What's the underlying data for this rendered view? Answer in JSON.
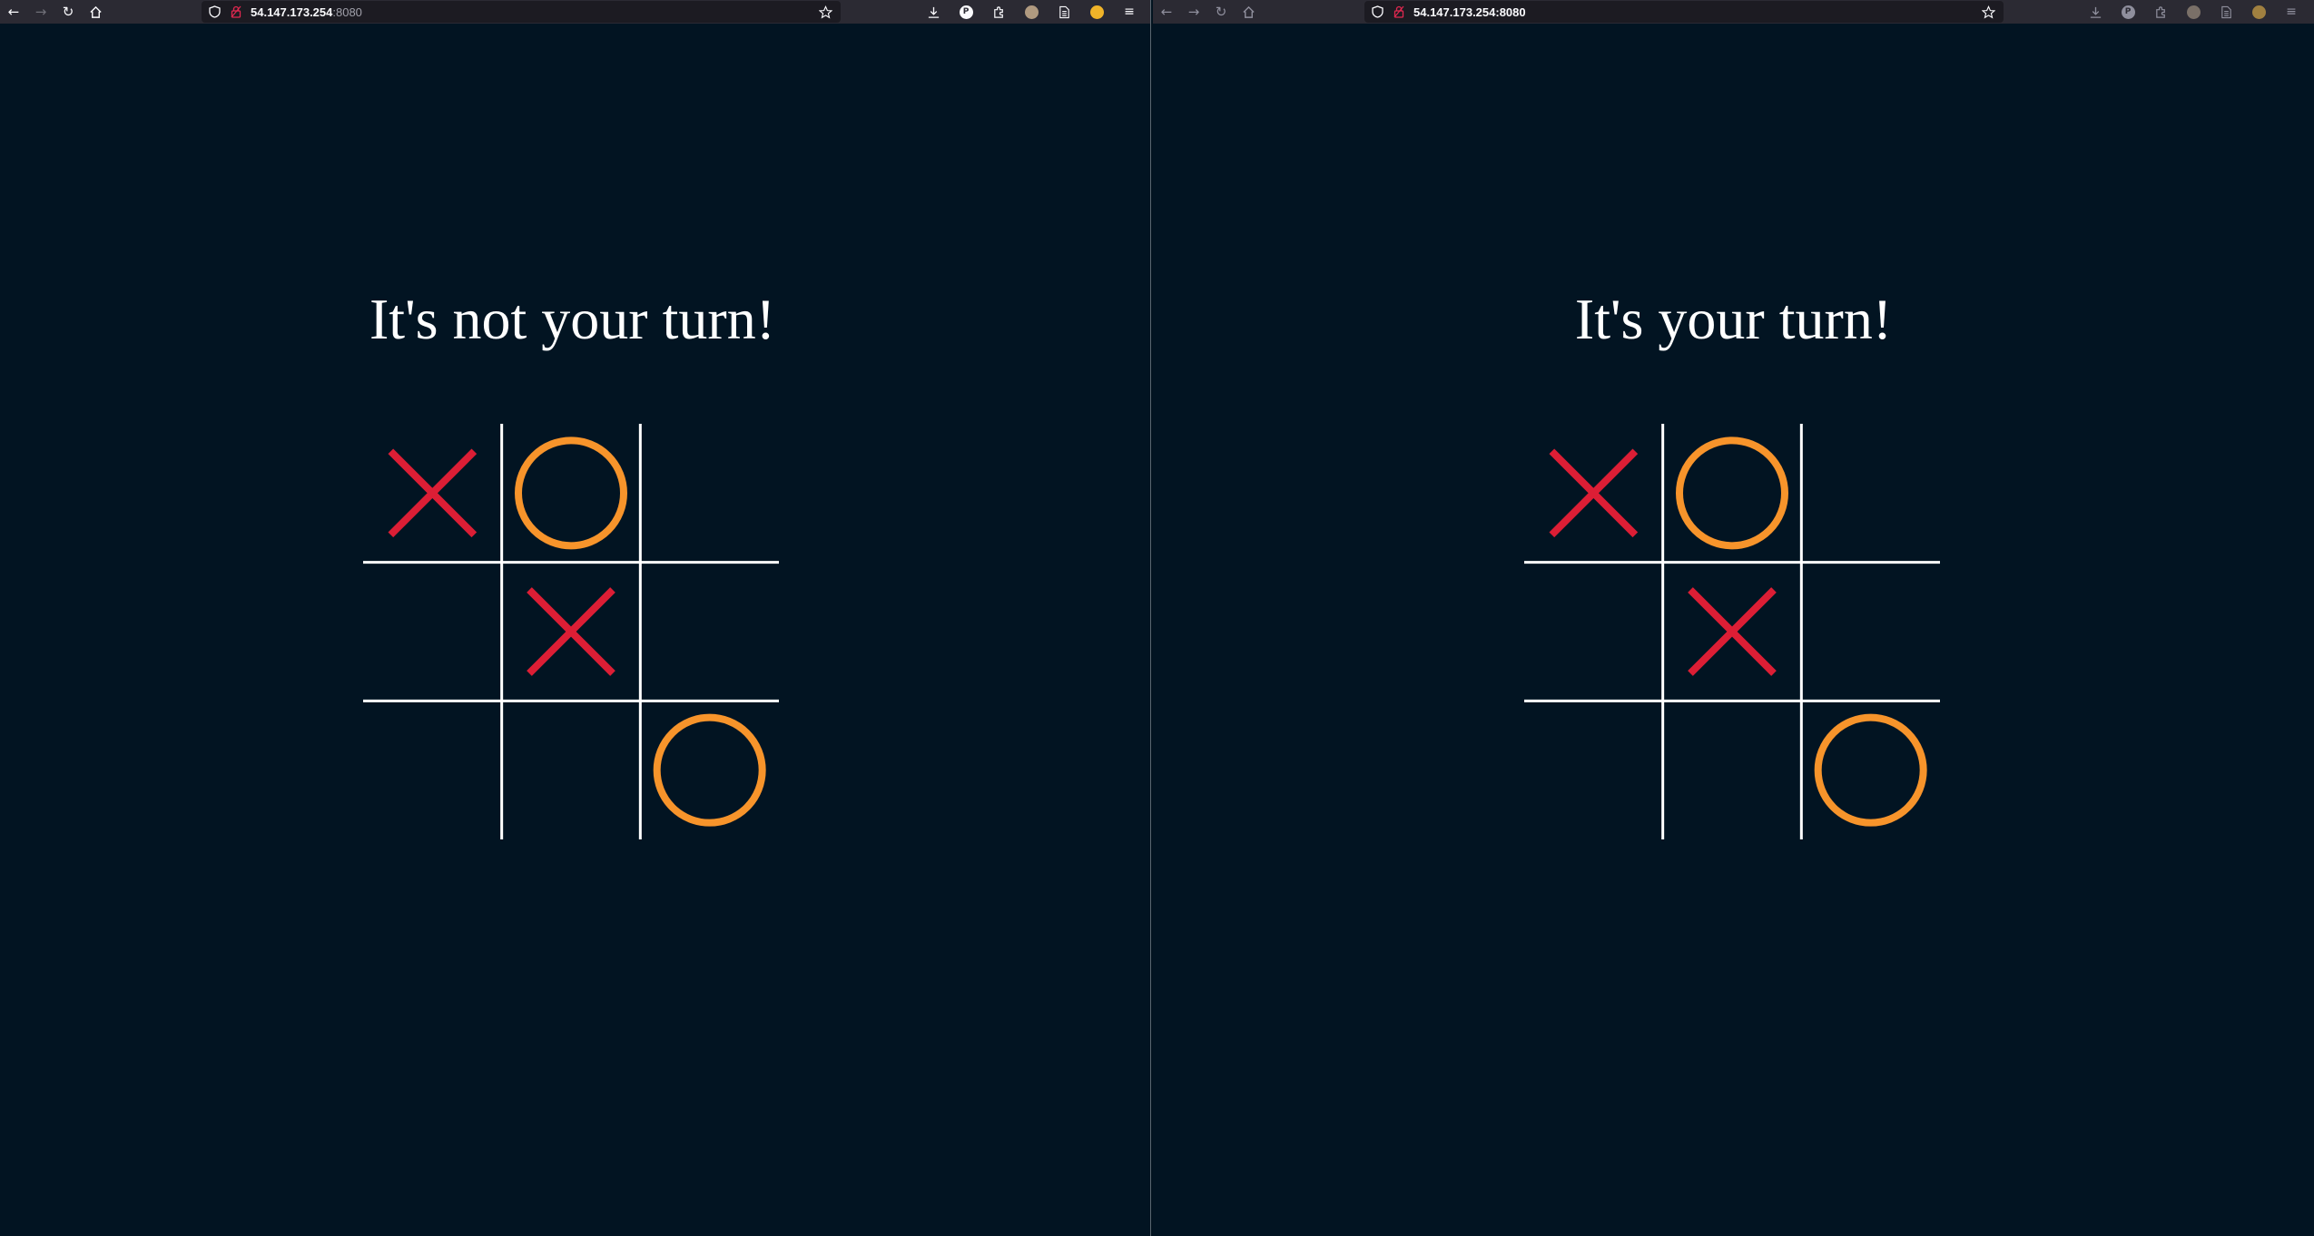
{
  "browsers": [
    {
      "url_host": "54.147.173.254",
      "url_port": ":8080",
      "status_message": "It's not your turn!",
      "board": [
        "X",
        "O",
        "",
        "",
        "X",
        "",
        "",
        "",
        "O"
      ]
    },
    {
      "url_host": "54.147.173.254",
      "url_port": ":8080",
      "status_message": "It's your turn!",
      "board": [
        "X",
        "O",
        "",
        "",
        "X",
        "",
        "",
        "",
        "O"
      ]
    }
  ],
  "toolbar": {
    "back_icon": "←",
    "forward_icon": "→",
    "reload_icon": "↻",
    "home_icon": "home-icon",
    "menu_icon": "≡",
    "extension_badge": "P"
  },
  "colors": {
    "x": "#dc1e35",
    "o": "#f7942b",
    "grid": "#ffffff",
    "background": "#021422"
  }
}
